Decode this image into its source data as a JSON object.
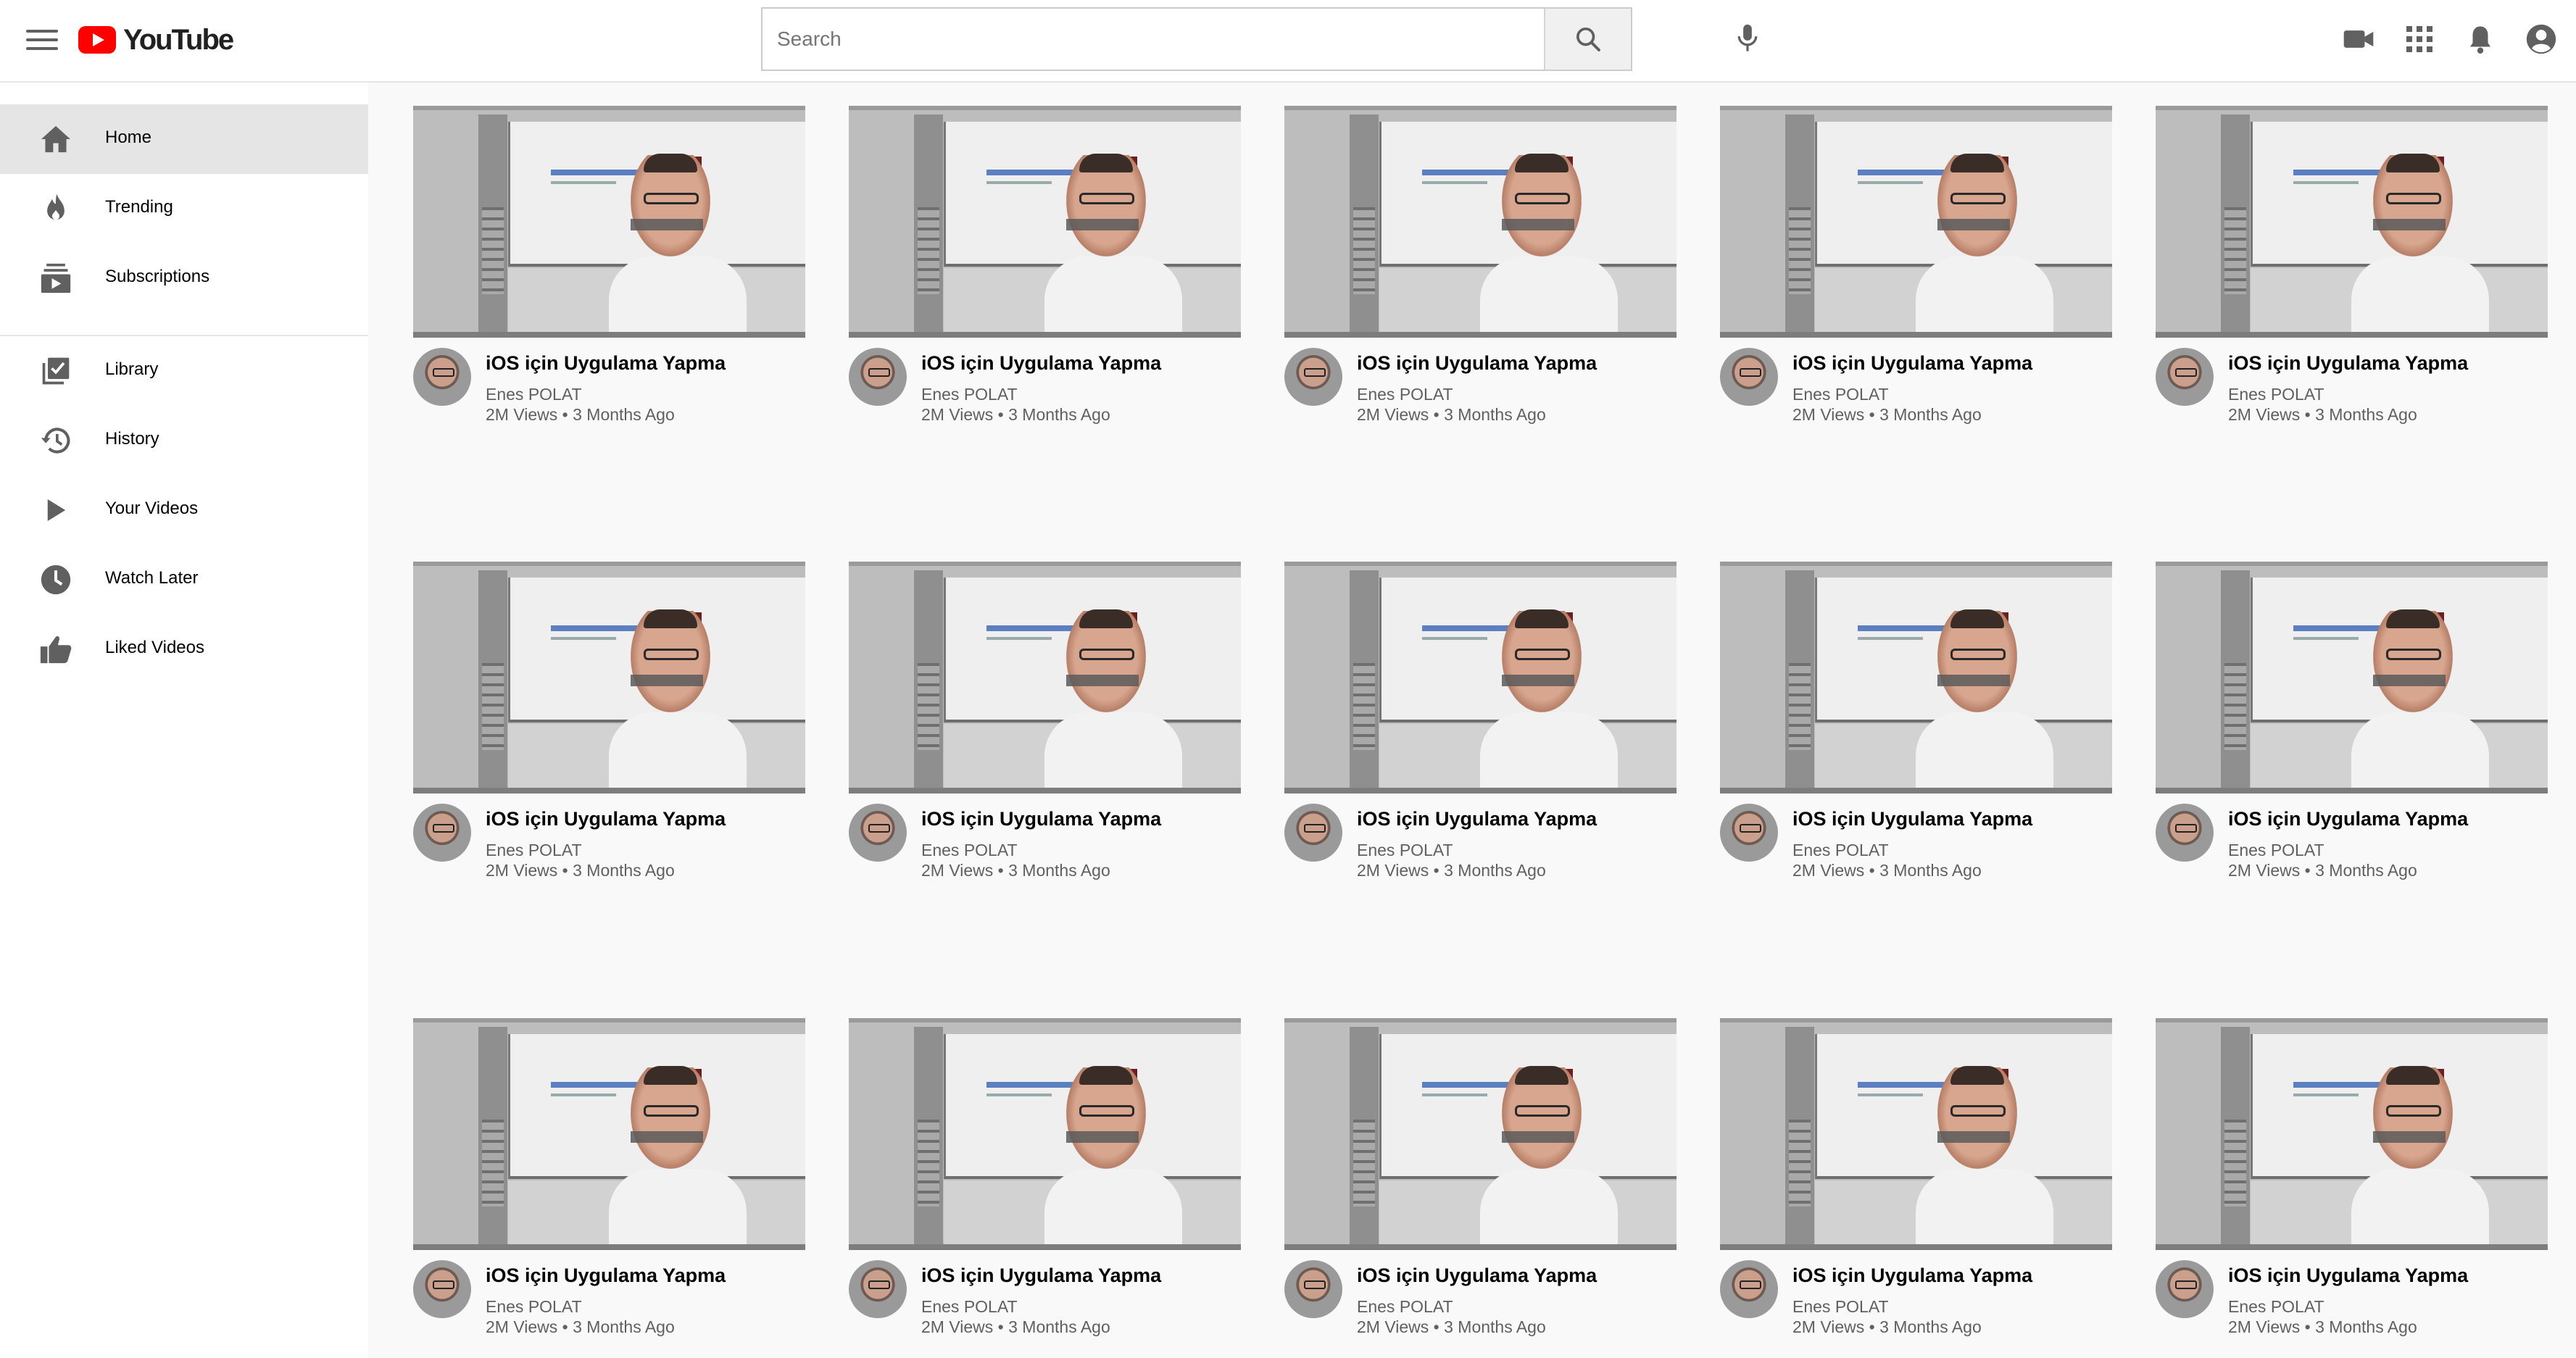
{
  "header": {
    "logo_text": "YouTube",
    "search_placeholder": "Search",
    "brand_color": "#ff0000"
  },
  "sidebar": {
    "items": [
      {
        "label": "Home",
        "icon": "home-icon",
        "active": true
      },
      {
        "label": "Trending",
        "icon": "trending-icon"
      },
      {
        "label": "Subscriptions",
        "icon": "subscriptions-icon"
      },
      {
        "label": "Library",
        "icon": "library-icon"
      },
      {
        "label": "History",
        "icon": "history-icon"
      },
      {
        "label": "Your Videos",
        "icon": "your-videos-icon"
      },
      {
        "label": "Watch Later",
        "icon": "watch-later-icon"
      },
      {
        "label": "Liked Videos",
        "icon": "liked-videos-icon"
      }
    ]
  },
  "videos": [
    {
      "title": "iOS için Uygulama Yapma",
      "channel": "Enes POLAT",
      "meta": "2M Views • 3 Months Ago"
    },
    {
      "title": "iOS için Uygulama Yapma",
      "channel": "Enes POLAT",
      "meta": "2M Views • 3 Months Ago"
    },
    {
      "title": "iOS için Uygulama Yapma",
      "channel": "Enes POLAT",
      "meta": "2M Views • 3 Months Ago"
    },
    {
      "title": "iOS için Uygulama Yapma",
      "channel": "Enes POLAT",
      "meta": "2M Views • 3 Months Ago"
    },
    {
      "title": "iOS için Uygulama Yapma",
      "channel": "Enes POLAT",
      "meta": "2M Views • 3 Months Ago"
    },
    {
      "title": "iOS için Uygulama Yapma",
      "channel": "Enes POLAT",
      "meta": "2M Views • 3 Months Ago"
    },
    {
      "title": "iOS için Uygulama Yapma",
      "channel": "Enes POLAT",
      "meta": "2M Views • 3 Months Ago"
    },
    {
      "title": "iOS için Uygulama Yapma",
      "channel": "Enes POLAT",
      "meta": "2M Views • 3 Months Ago"
    },
    {
      "title": "iOS için Uygulama Yapma",
      "channel": "Enes POLAT",
      "meta": "2M Views • 3 Months Ago"
    },
    {
      "title": "iOS için Uygulama Yapma",
      "channel": "Enes POLAT",
      "meta": "2M Views • 3 Months Ago"
    },
    {
      "title": "iOS için Uygulama Yapma",
      "channel": "Enes POLAT",
      "meta": "2M Views • 3 Months Ago"
    },
    {
      "title": "iOS için Uygulama Yapma",
      "channel": "Enes POLAT",
      "meta": "2M Views • 3 Months Ago"
    },
    {
      "title": "iOS için Uygulama Yapma",
      "channel": "Enes POLAT",
      "meta": "2M Views • 3 Months Ago"
    },
    {
      "title": "iOS için Uygulama Yapma",
      "channel": "Enes POLAT",
      "meta": "2M Views • 3 Months Ago"
    },
    {
      "title": "iOS için Uygulama Yapma",
      "channel": "Enes POLAT",
      "meta": "2M Views • 3 Months Ago"
    }
  ]
}
